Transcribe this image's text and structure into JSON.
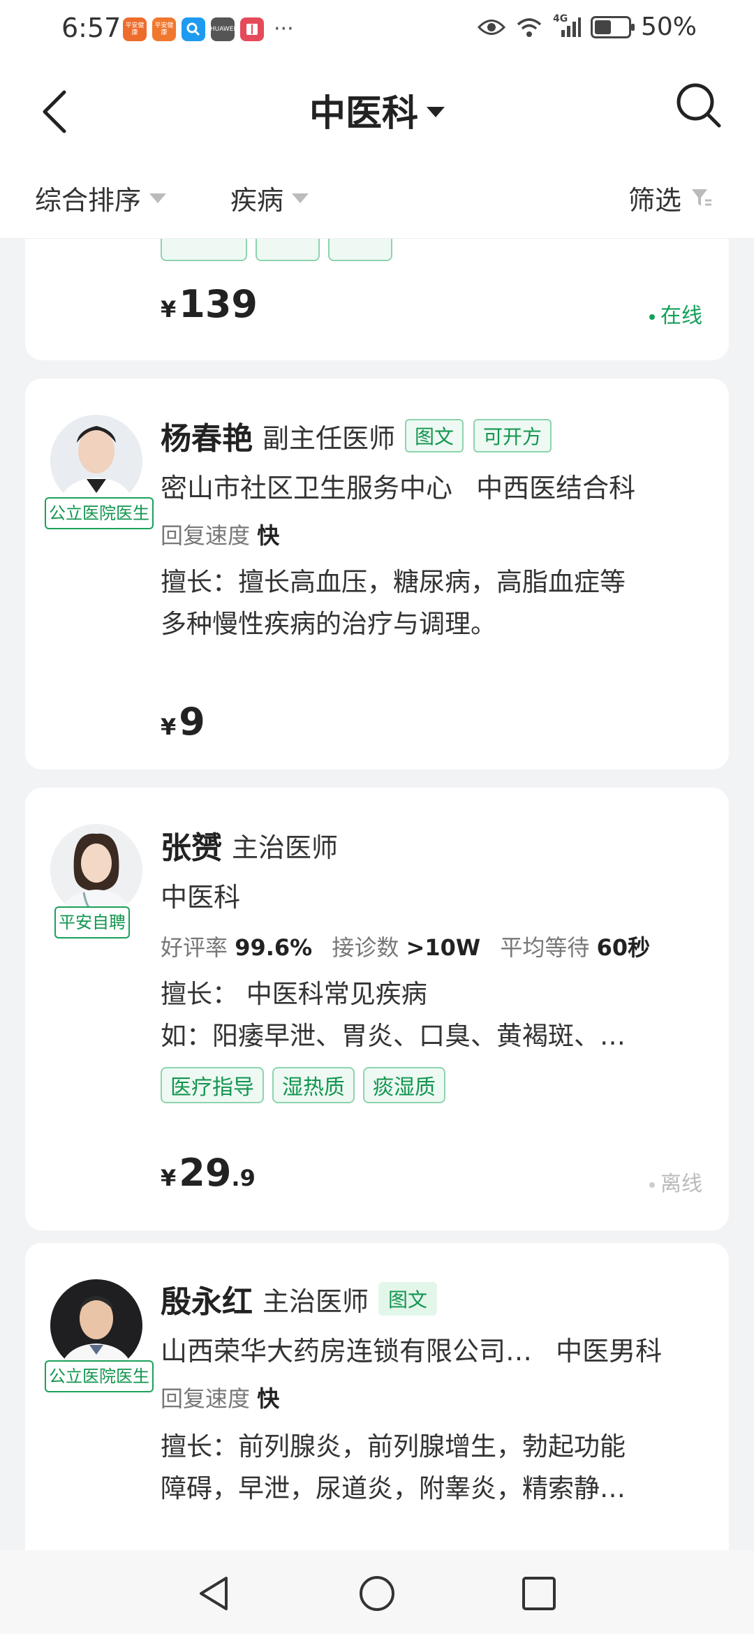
{
  "status_bar": {
    "time": "6:57",
    "apps": [
      {
        "icon": "pingan-health-app-icon",
        "text": "平安健康",
        "color": "#ee6c2b"
      },
      {
        "icon": "pingan-health-app-icon-2",
        "text": "平安健康",
        "color": "#f0782e"
      },
      {
        "icon": "search-app-icon",
        "text": "",
        "color": "#1e9bf0"
      },
      {
        "icon": "huawei-app-icon",
        "text": "HUAWEI",
        "color": "#555555"
      },
      {
        "icon": "book-app-icon",
        "text": "",
        "color": "#e54a5a"
      }
    ],
    "more": "···",
    "network": "4G",
    "battery_level": 0.5,
    "battery": "50%"
  },
  "header": {
    "title": "中医科"
  },
  "filters": {
    "sort": "综合排序",
    "disease": "疾病",
    "filter": "筛选"
  },
  "colors": {
    "accent_green": "#12954f",
    "online_green": "#12a05a"
  },
  "cards": [
    {
      "price_int": "139",
      "price_dec": "",
      "status": "在线"
    },
    {
      "name": "杨春艳",
      "title": "副主任医师",
      "badges": [
        "图文",
        "可开方"
      ],
      "avatar_badge": "公立医院医生",
      "hospital": "密山市社区卫生服务中心",
      "department": "中西医结合科",
      "reply_label": "回复速度",
      "reply_value": "快",
      "skill_lines": [
        "擅长：擅长高血压，糖尿病，高脂血症等",
        "多种慢性疾病的治疗与调理。"
      ],
      "price_int": "9",
      "price_dec": ""
    },
    {
      "name": "张赟",
      "title": "主治医师",
      "avatar_badge": "平安自聘",
      "department": "中医科",
      "rating_label": "好评率",
      "rating_value": "99.6%",
      "visits_label": "接诊数",
      "visits_value": ">10W",
      "wait_label": "平均等待",
      "wait_value": "60秒",
      "skill_lines": [
        "擅长：  中医科常见疾病",
        "如：阳痿早泄、胃炎、口臭、黄褐斑、…"
      ],
      "tags": [
        "医疗指导",
        "湿热质",
        "痰湿质"
      ],
      "price_int": "29",
      "price_dec": ".9",
      "status": "离线"
    },
    {
      "name": "殷永红",
      "title": "主治医师",
      "badges": [
        "图文"
      ],
      "avatar_badge": "公立医院医生",
      "hospital": "山西荣华大药房连锁有限公司…",
      "department": "中医男科",
      "reply_label": "回复速度",
      "reply_value": "快",
      "skill_lines": [
        "擅长：前列腺炎，前列腺增生，勃起功能",
        "障碍，早泄，尿道炎，附睾炎，精索静…"
      ]
    }
  ]
}
